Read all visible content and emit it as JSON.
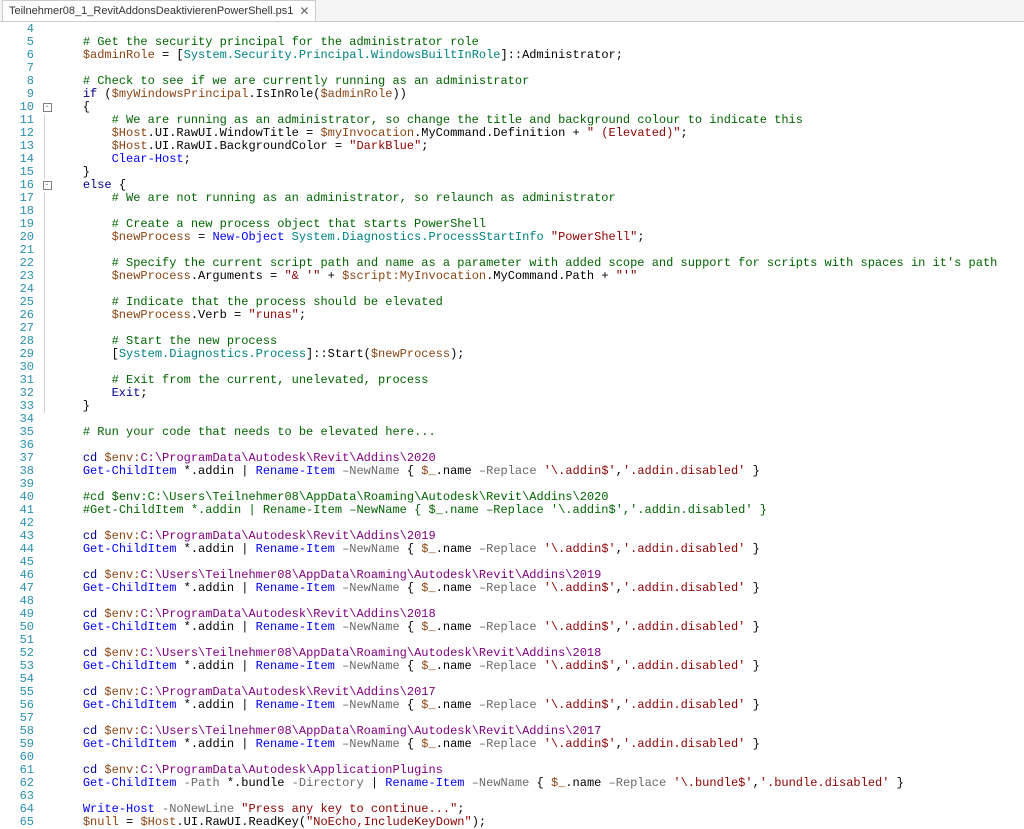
{
  "tab": {
    "title": "Teilnehmer08_1_RevitAddonsDeaktivierenPowerShell.ps1",
    "close": "✕"
  },
  "first_line": 4,
  "last_line": 65,
  "fold": {
    "10": "⊟",
    "16": "⊟"
  },
  "code": {
    "4": [],
    "5": [
      [
        "ind",
        1
      ],
      [
        "com",
        "# Get the security principal for the administrator role"
      ]
    ],
    "6": [
      [
        "ind",
        1
      ],
      [
        "var",
        "$adminRole"
      ],
      [
        "txt",
        " = ["
      ],
      [
        "type",
        "System.Security.Principal.WindowsBuiltInRole"
      ],
      [
        "txt",
        "]::Administrator;"
      ]
    ],
    "7": [],
    "8": [
      [
        "ind",
        1
      ],
      [
        "com",
        "# Check to see if we are currently running as an administrator"
      ]
    ],
    "9": [
      [
        "ind",
        1
      ],
      [
        "key",
        "if"
      ],
      [
        "txt",
        " ("
      ],
      [
        "var",
        "$myWindowsPrincipal"
      ],
      [
        "txt",
        ".IsInRole("
      ],
      [
        "var",
        "$adminRole"
      ],
      [
        "txt",
        "))"
      ]
    ],
    "10": [
      [
        "ind",
        1
      ],
      [
        "txt",
        "{"
      ]
    ],
    "11": [
      [
        "ind",
        2
      ],
      [
        "com",
        "# We are running as an administrator, so change the title and background colour to indicate this"
      ]
    ],
    "12": [
      [
        "ind",
        2
      ],
      [
        "var",
        "$Host"
      ],
      [
        "txt",
        ".UI.RawUI.WindowTitle = "
      ],
      [
        "var",
        "$myInvocation"
      ],
      [
        "txt",
        ".MyCommand.Definition + "
      ],
      [
        "str",
        "\" (Elevated)\""
      ],
      [
        "txt",
        ";"
      ]
    ],
    "13": [
      [
        "ind",
        2
      ],
      [
        "var",
        "$Host"
      ],
      [
        "txt",
        ".UI.RawUI.BackgroundColor = "
      ],
      [
        "str",
        "\"DarkBlue\""
      ],
      [
        "txt",
        ";"
      ]
    ],
    "14": [
      [
        "ind",
        2
      ],
      [
        "cmd",
        "Clear-Host"
      ],
      [
        "txt",
        ";"
      ]
    ],
    "15": [
      [
        "ind",
        1
      ],
      [
        "txt",
        "}"
      ]
    ],
    "16": [
      [
        "ind",
        1
      ],
      [
        "key",
        "else"
      ],
      [
        "txt",
        " {"
      ]
    ],
    "17": [
      [
        "ind",
        2
      ],
      [
        "com",
        "# We are not running as an administrator, so relaunch as administrator"
      ]
    ],
    "18": [],
    "19": [
      [
        "ind",
        2
      ],
      [
        "com",
        "# Create a new process object that starts PowerShell"
      ]
    ],
    "20": [
      [
        "ind",
        2
      ],
      [
        "var",
        "$newProcess"
      ],
      [
        "txt",
        " = "
      ],
      [
        "cmd",
        "New-Object"
      ],
      [
        "txt",
        " "
      ],
      [
        "type",
        "System.Diagnostics.ProcessStartInfo"
      ],
      [
        "txt",
        " "
      ],
      [
        "str",
        "\"PowerShell\""
      ],
      [
        "txt",
        ";"
      ]
    ],
    "21": [],
    "22": [
      [
        "ind",
        2
      ],
      [
        "com",
        "# Specify the current script path and name as a parameter with added scope and support for scripts with spaces in it's path"
      ]
    ],
    "23": [
      [
        "ind",
        2
      ],
      [
        "var",
        "$newProcess"
      ],
      [
        "txt",
        ".Arguments = "
      ],
      [
        "str",
        "\"& '\""
      ],
      [
        "txt",
        " + "
      ],
      [
        "var",
        "$script:MyInvocation"
      ],
      [
        "txt",
        ".MyCommand.Path + "
      ],
      [
        "str",
        "\"'\""
      ]
    ],
    "24": [],
    "25": [
      [
        "ind",
        2
      ],
      [
        "com",
        "# Indicate that the process should be elevated"
      ]
    ],
    "26": [
      [
        "ind",
        2
      ],
      [
        "var",
        "$newProcess"
      ],
      [
        "txt",
        ".Verb = "
      ],
      [
        "str",
        "\"runas\""
      ],
      [
        "txt",
        ";"
      ]
    ],
    "27": [],
    "28": [
      [
        "ind",
        2
      ],
      [
        "com",
        "# Start the new process"
      ]
    ],
    "29": [
      [
        "ind",
        2
      ],
      [
        "txt",
        "["
      ],
      [
        "type",
        "System.Diagnostics.Process"
      ],
      [
        "txt",
        "]::Start("
      ],
      [
        "var",
        "$newProcess"
      ],
      [
        "txt",
        ");"
      ]
    ],
    "30": [],
    "31": [
      [
        "ind",
        2
      ],
      [
        "com",
        "# Exit from the current, unelevated, process"
      ]
    ],
    "32": [
      [
        "ind",
        2
      ],
      [
        "key",
        "Exit"
      ],
      [
        "txt",
        ";"
      ]
    ],
    "33": [
      [
        "ind",
        1
      ],
      [
        "txt",
        "}"
      ]
    ],
    "34": [],
    "35": [
      [
        "ind",
        1
      ],
      [
        "com",
        "# Run your code that needs to be elevated here..."
      ]
    ],
    "36": [],
    "37": [
      [
        "ind",
        1
      ],
      [
        "key",
        "cd"
      ],
      [
        "txt",
        " "
      ],
      [
        "var",
        "$env:"
      ],
      [
        "path",
        "C:\\ProgramData\\Autodesk\\Revit\\Addins\\2020"
      ]
    ],
    "38": [
      [
        "ind",
        1
      ],
      [
        "cmd",
        "Get-ChildItem"
      ],
      [
        "txt",
        " *.addin | "
      ],
      [
        "cmd",
        "Rename-Item"
      ],
      [
        "txt",
        " "
      ],
      [
        "op",
        "–NewName"
      ],
      [
        "txt",
        " { "
      ],
      [
        "var",
        "$_"
      ],
      [
        "txt",
        ".name "
      ],
      [
        "op",
        "–Replace"
      ],
      [
        "txt",
        " "
      ],
      [
        "str",
        "'\\.addin$'"
      ],
      [
        "txt",
        ","
      ],
      [
        "str",
        "'.addin.disabled'"
      ],
      [
        "txt",
        " }"
      ]
    ],
    "39": [],
    "40": [
      [
        "ind",
        1
      ],
      [
        "com",
        "#cd $env:C:\\Users\\Teilnehmer08\\AppData\\Roaming\\Autodesk\\Revit\\Addins\\2020"
      ]
    ],
    "41": [
      [
        "ind",
        1
      ],
      [
        "com",
        "#Get-ChildItem *.addin | Rename-Item –NewName { $_.name –Replace '\\.addin$','.addin.disabled' }"
      ]
    ],
    "42": [],
    "43": [
      [
        "ind",
        1
      ],
      [
        "key",
        "cd"
      ],
      [
        "txt",
        " "
      ],
      [
        "var",
        "$env:"
      ],
      [
        "path",
        "C:\\ProgramData\\Autodesk\\Revit\\Addins\\2019"
      ]
    ],
    "44": [
      [
        "ind",
        1
      ],
      [
        "cmd",
        "Get-ChildItem"
      ],
      [
        "txt",
        " *.addin | "
      ],
      [
        "cmd",
        "Rename-Item"
      ],
      [
        "txt",
        " "
      ],
      [
        "op",
        "–NewName"
      ],
      [
        "txt",
        " { "
      ],
      [
        "var",
        "$_"
      ],
      [
        "txt",
        ".name "
      ],
      [
        "op",
        "–Replace"
      ],
      [
        "txt",
        " "
      ],
      [
        "str",
        "'\\.addin$'"
      ],
      [
        "txt",
        ","
      ],
      [
        "str",
        "'.addin.disabled'"
      ],
      [
        "txt",
        " }"
      ]
    ],
    "45": [],
    "46": [
      [
        "ind",
        1
      ],
      [
        "key",
        "cd"
      ],
      [
        "txt",
        " "
      ],
      [
        "var",
        "$env:"
      ],
      [
        "path",
        "C:\\Users\\Teilnehmer08\\AppData\\Roaming\\Autodesk\\Revit\\Addins\\2019"
      ]
    ],
    "47": [
      [
        "ind",
        1
      ],
      [
        "cmd",
        "Get-ChildItem"
      ],
      [
        "txt",
        " *.addin | "
      ],
      [
        "cmd",
        "Rename-Item"
      ],
      [
        "txt",
        " "
      ],
      [
        "op",
        "–NewName"
      ],
      [
        "txt",
        " { "
      ],
      [
        "var",
        "$_"
      ],
      [
        "txt",
        ".name "
      ],
      [
        "op",
        "–Replace"
      ],
      [
        "txt",
        " "
      ],
      [
        "str",
        "'\\.addin$'"
      ],
      [
        "txt",
        ","
      ],
      [
        "str",
        "'.addin.disabled'"
      ],
      [
        "txt",
        " }"
      ]
    ],
    "48": [],
    "49": [
      [
        "ind",
        1
      ],
      [
        "key",
        "cd"
      ],
      [
        "txt",
        " "
      ],
      [
        "var",
        "$env:"
      ],
      [
        "path",
        "C:\\ProgramData\\Autodesk\\Revit\\Addins\\2018"
      ]
    ],
    "50": [
      [
        "ind",
        1
      ],
      [
        "cmd",
        "Get-ChildItem"
      ],
      [
        "txt",
        " *.addin | "
      ],
      [
        "cmd",
        "Rename-Item"
      ],
      [
        "txt",
        " "
      ],
      [
        "op",
        "–NewName"
      ],
      [
        "txt",
        " { "
      ],
      [
        "var",
        "$_"
      ],
      [
        "txt",
        ".name "
      ],
      [
        "op",
        "–Replace"
      ],
      [
        "txt",
        " "
      ],
      [
        "str",
        "'\\.addin$'"
      ],
      [
        "txt",
        ","
      ],
      [
        "str",
        "'.addin.disabled'"
      ],
      [
        "txt",
        " }"
      ]
    ],
    "51": [],
    "52": [
      [
        "ind",
        1
      ],
      [
        "key",
        "cd"
      ],
      [
        "txt",
        " "
      ],
      [
        "var",
        "$env:"
      ],
      [
        "path",
        "C:\\Users\\Teilnehmer08\\AppData\\Roaming\\Autodesk\\Revit\\Addins\\2018"
      ]
    ],
    "53": [
      [
        "ind",
        1
      ],
      [
        "cmd",
        "Get-ChildItem"
      ],
      [
        "txt",
        " *.addin | "
      ],
      [
        "cmd",
        "Rename-Item"
      ],
      [
        "txt",
        " "
      ],
      [
        "op",
        "–NewName"
      ],
      [
        "txt",
        " { "
      ],
      [
        "var",
        "$_"
      ],
      [
        "txt",
        ".name "
      ],
      [
        "op",
        "–Replace"
      ],
      [
        "txt",
        " "
      ],
      [
        "str",
        "'\\.addin$'"
      ],
      [
        "txt",
        ","
      ],
      [
        "str",
        "'.addin.disabled'"
      ],
      [
        "txt",
        " }"
      ]
    ],
    "54": [],
    "55": [
      [
        "ind",
        1
      ],
      [
        "key",
        "cd"
      ],
      [
        "txt",
        " "
      ],
      [
        "var",
        "$env:"
      ],
      [
        "path",
        "C:\\ProgramData\\Autodesk\\Revit\\Addins\\2017"
      ]
    ],
    "56": [
      [
        "ind",
        1
      ],
      [
        "cmd",
        "Get-ChildItem"
      ],
      [
        "txt",
        " *.addin | "
      ],
      [
        "cmd",
        "Rename-Item"
      ],
      [
        "txt",
        " "
      ],
      [
        "op",
        "–NewName"
      ],
      [
        "txt",
        " { "
      ],
      [
        "var",
        "$_"
      ],
      [
        "txt",
        ".name "
      ],
      [
        "op",
        "–Replace"
      ],
      [
        "txt",
        " "
      ],
      [
        "str",
        "'\\.addin$'"
      ],
      [
        "txt",
        ","
      ],
      [
        "str",
        "'.addin.disabled'"
      ],
      [
        "txt",
        " }"
      ]
    ],
    "57": [],
    "58": [
      [
        "ind",
        1
      ],
      [
        "key",
        "cd"
      ],
      [
        "txt",
        " "
      ],
      [
        "var",
        "$env:"
      ],
      [
        "path",
        "C:\\Users\\Teilnehmer08\\AppData\\Roaming\\Autodesk\\Revit\\Addins\\2017"
      ]
    ],
    "59": [
      [
        "ind",
        1
      ],
      [
        "cmd",
        "Get-ChildItem"
      ],
      [
        "txt",
        " *.addin | "
      ],
      [
        "cmd",
        "Rename-Item"
      ],
      [
        "txt",
        " "
      ],
      [
        "op",
        "–NewName"
      ],
      [
        "txt",
        " { "
      ],
      [
        "var",
        "$_"
      ],
      [
        "txt",
        ".name "
      ],
      [
        "op",
        "–Replace"
      ],
      [
        "txt",
        " "
      ],
      [
        "str",
        "'\\.addin$'"
      ],
      [
        "txt",
        ","
      ],
      [
        "str",
        "'.addin.disabled'"
      ],
      [
        "txt",
        " }"
      ]
    ],
    "60": [],
    "61": [
      [
        "ind",
        1
      ],
      [
        "key",
        "cd"
      ],
      [
        "txt",
        " "
      ],
      [
        "var",
        "$env:"
      ],
      [
        "path",
        "C:\\ProgramData\\Autodesk\\ApplicationPlugins"
      ]
    ],
    "62": [
      [
        "ind",
        1
      ],
      [
        "cmd",
        "Get-ChildItem"
      ],
      [
        "txt",
        " "
      ],
      [
        "op",
        "-Path"
      ],
      [
        "txt",
        " *.bundle "
      ],
      [
        "op",
        "-Directory"
      ],
      [
        "txt",
        " | "
      ],
      [
        "cmd",
        "Rename-Item"
      ],
      [
        "txt",
        " "
      ],
      [
        "op",
        "–NewName"
      ],
      [
        "txt",
        " { "
      ],
      [
        "var",
        "$_"
      ],
      [
        "txt",
        ".name "
      ],
      [
        "op",
        "–Replace"
      ],
      [
        "txt",
        " "
      ],
      [
        "str",
        "'\\.bundle$'"
      ],
      [
        "txt",
        ","
      ],
      [
        "str",
        "'.bundle.disabled'"
      ],
      [
        "txt",
        " }"
      ]
    ],
    "63": [],
    "64": [
      [
        "ind",
        1
      ],
      [
        "cmd",
        "Write-Host"
      ],
      [
        "txt",
        " "
      ],
      [
        "op",
        "-NoNewLine"
      ],
      [
        "txt",
        " "
      ],
      [
        "str",
        "\"Press any key to continue...\""
      ],
      [
        "txt",
        ";"
      ]
    ],
    "65": [
      [
        "ind",
        1
      ],
      [
        "var",
        "$null"
      ],
      [
        "txt",
        " = "
      ],
      [
        "var",
        "$Host"
      ],
      [
        "txt",
        ".UI.RawUI.ReadKey("
      ],
      [
        "str",
        "\"NoEcho,IncludeKeyDown\""
      ],
      [
        "txt",
        ");"
      ]
    ]
  }
}
